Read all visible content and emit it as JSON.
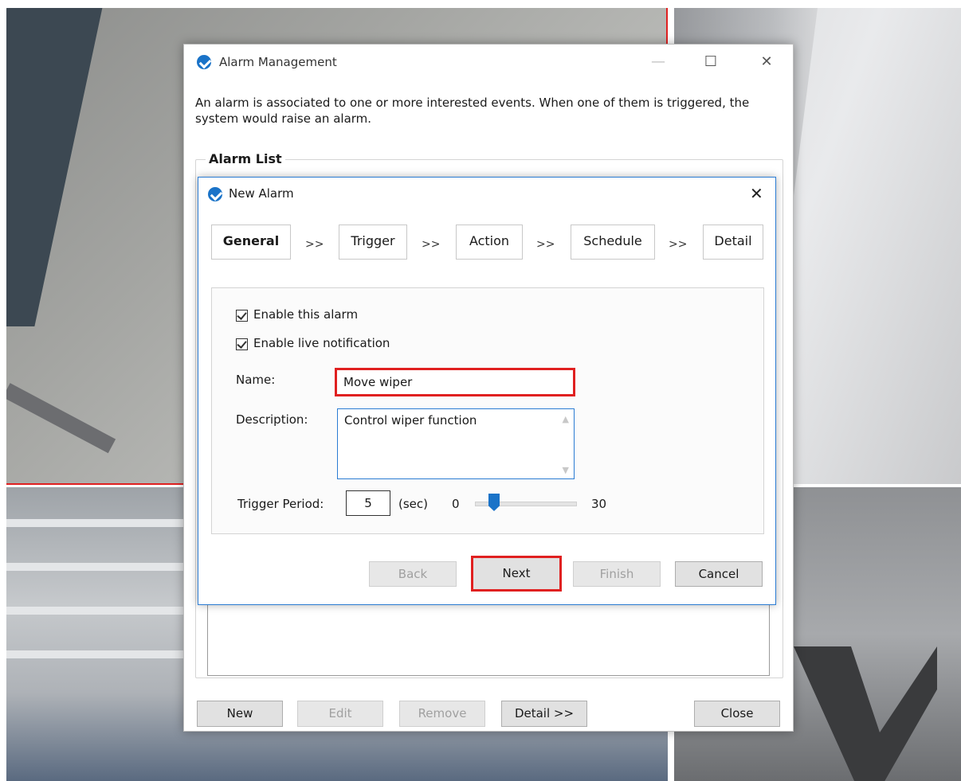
{
  "main_window": {
    "title": "Alarm Management",
    "description": "An alarm is associated to one or more interested events. When one of them is triggered, the system would raise an alarm.",
    "list_label": "Alarm List",
    "buttons": {
      "new": "New",
      "edit": "Edit",
      "remove": "Remove",
      "detail": "Detail >>",
      "close": "Close"
    }
  },
  "dialog": {
    "title": "New Alarm",
    "steps": [
      "General",
      "Trigger",
      "Action",
      "Schedule",
      "Detail"
    ],
    "step_separator": ">>",
    "active_step": "General",
    "enable_alarm_label": "Enable this alarm",
    "enable_alarm_checked": true,
    "enable_live_label": "Enable live notification",
    "enable_live_checked": true,
    "name_label": "Name:",
    "name_value": "Move wiper",
    "description_label": "Description:",
    "description_value": "Control wiper function",
    "trigger_period_label": "Trigger Period:",
    "trigger_period_value": "5",
    "trigger_period_unit": "(sec)",
    "slider_min": "0",
    "slider_max": "30",
    "buttons": {
      "back": "Back",
      "next": "Next",
      "finish": "Finish",
      "cancel": "Cancel"
    }
  },
  "colors": {
    "highlight": "#e02020",
    "accent": "#1a73c8",
    "dialog_border": "#2b7cd3"
  }
}
